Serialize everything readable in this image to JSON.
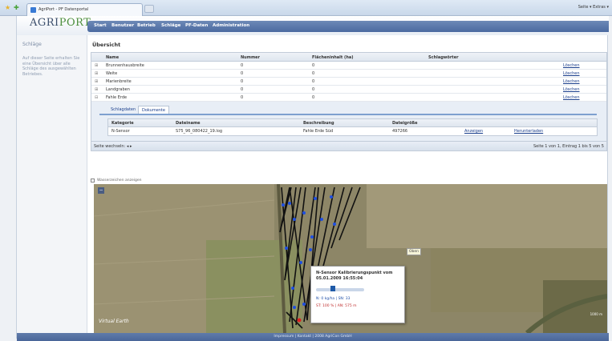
{
  "browser": {
    "tab_title": "AgriPort - PF Datenportal",
    "right_toolbar": "Seite ▾  Extras ▾"
  },
  "header": {
    "logo_main": "AGRI",
    "logo_accent": "PORT",
    "nav": [
      "Start",
      "Benutzer",
      "Betrieb",
      "Schläge",
      "PF-Daten",
      "Administration"
    ]
  },
  "sidebar": {
    "title": "Schläge",
    "description": "Auf dieser Seite erhalten Sie eine Übersicht über alle Schläge des ausgewählten Betriebes."
  },
  "main": {
    "title": "Übersicht",
    "columns": [
      "Name",
      "Nummer",
      "Flächeninhalt (ha)",
      "Schlagwörter"
    ],
    "rows": [
      {
        "name": "Brunnenhausbreite",
        "nummer": "0",
        "flaeche": "0",
        "schlagwoerter": "",
        "action": "Löschen"
      },
      {
        "name": "Weite",
        "nummer": "0",
        "flaeche": "0",
        "schlagwoerter": "",
        "action": "Löschen"
      },
      {
        "name": "Marienbreite",
        "nummer": "0",
        "flaeche": "0",
        "schlagwoerter": "",
        "action": "Löschen"
      },
      {
        "name": "Landgraben",
        "nummer": "0",
        "flaeche": "0",
        "schlagwoerter": "",
        "action": "Löschen"
      },
      {
        "name": "Fahle Erde",
        "nummer": "0",
        "flaeche": "0",
        "schlagwoerter": "",
        "action": "Löschen"
      }
    ],
    "subtabs": [
      "Schlagdaten",
      "Dokumente"
    ],
    "subcolumns": [
      "Kategorie",
      "Dateiname",
      "Beschreibung",
      "Dateigröße"
    ],
    "subrows": [
      {
        "kategorie": "N-Sensor",
        "dateiname": "S75_96_080422_19.log",
        "beschreibung": "Fahle Erde Süd",
        "groesse": "497266",
        "action1": "Anzeigen",
        "action2": "Herunterladen"
      }
    ],
    "pager_left": "Seite wechseln:  ◂  ▸",
    "pager_right": "Seite 1 von 1, Eintrag 1 bis 5 von 5",
    "checkbox_label": "Wasserzeichen anzeigen"
  },
  "map": {
    "zoom_button": "−",
    "popup_title": "N-Sensor Kalibrierungspunkt vom 05.01.2009 16:55:04",
    "popup_line1": "N:  0 kg/ha  |  SN:  33",
    "popup_line2": "ST:  100 %  |  AN:  575 m",
    "marker_label": "Oben",
    "logo": "Virtual Earth",
    "scale": "1000 m"
  },
  "footer": {
    "text": "Impressum  |  Kontakt  |  2008 AgriCon GmbH"
  },
  "colors": {
    "nav_bg": "#4b6aa0",
    "link": "#1a3e8c",
    "logo_green": "#4b8e3c"
  }
}
